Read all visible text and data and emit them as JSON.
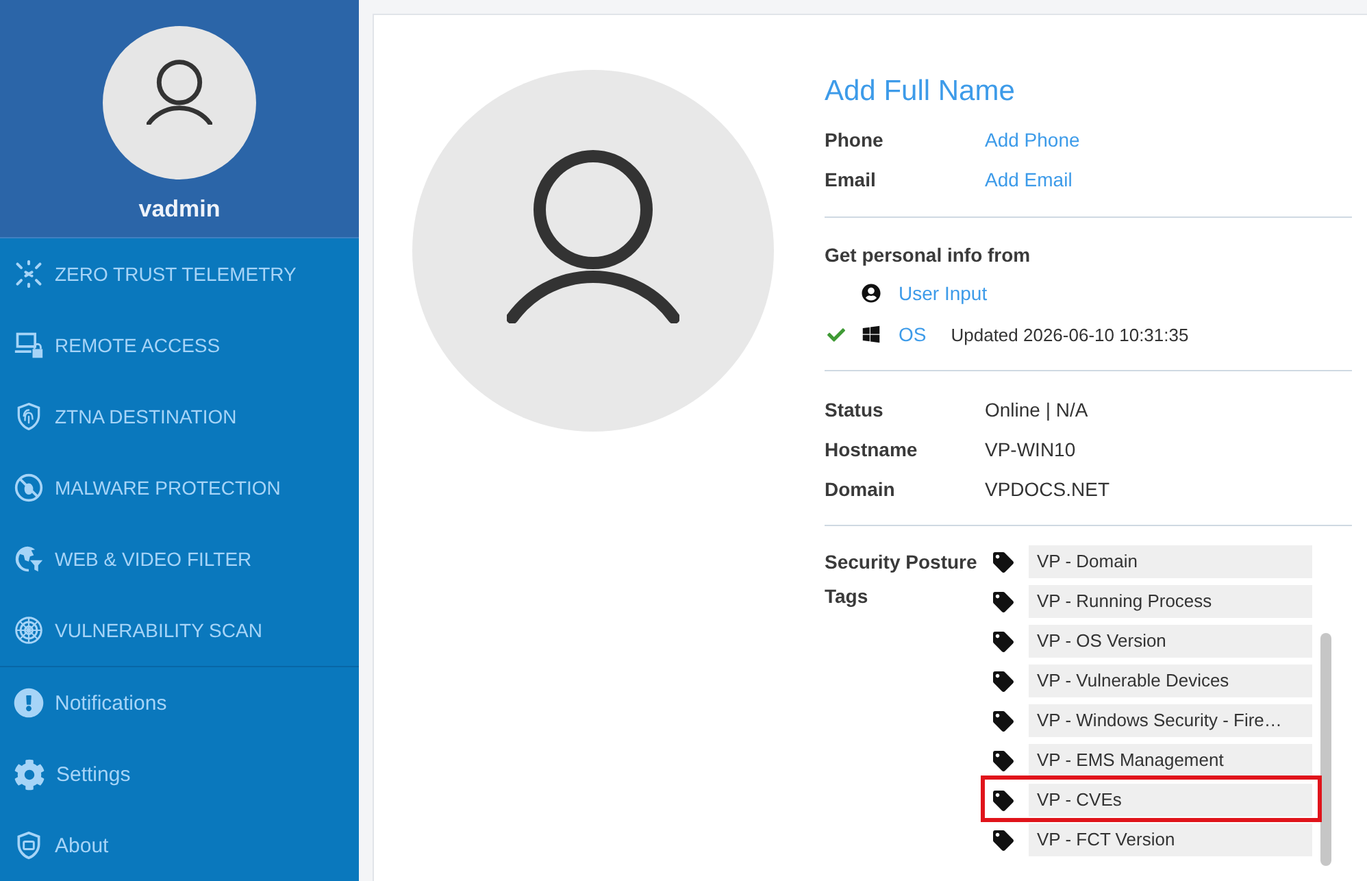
{
  "sidebar": {
    "user": {
      "name": "vadmin"
    },
    "modules": [
      {
        "label": "ZERO TRUST TELEMETRY"
      },
      {
        "label": "REMOTE ACCESS"
      },
      {
        "label": "ZTNA DESTINATION"
      },
      {
        "label": "MALWARE PROTECTION"
      },
      {
        "label": "WEB & VIDEO FILTER"
      },
      {
        "label": "VULNERABILITY SCAN"
      }
    ],
    "footer_items": [
      {
        "label": "Notifications"
      },
      {
        "label": "Settings"
      },
      {
        "label": "About"
      }
    ]
  },
  "profile": {
    "full_name": "Add Full Name",
    "contacts": [
      {
        "label": "Phone",
        "value": "Add Phone"
      },
      {
        "label": "Email",
        "value": "Add Email"
      }
    ],
    "info_source": {
      "heading": "Get personal info from",
      "sources": [
        {
          "kind": "user",
          "label": "User Input",
          "checked": false
        },
        {
          "kind": "os",
          "label": "OS",
          "checked": true,
          "updated": "Updated 2026-06-10 10:31:35"
        }
      ]
    },
    "details": [
      {
        "label": "Status",
        "value": "Online | N/A"
      },
      {
        "label": "Hostname",
        "value": "VP-WIN10"
      },
      {
        "label": "Domain",
        "value": "VPDOCS.NET"
      }
    ],
    "tags": {
      "label": "Security Posture Tags",
      "items": [
        {
          "label": "VP - Domain",
          "highlighted": false
        },
        {
          "label": "VP - Running Process",
          "highlighted": false
        },
        {
          "label": "VP - OS Version",
          "highlighted": false
        },
        {
          "label": "VP - Vulnerable Devices",
          "highlighted": false
        },
        {
          "label": "VP - Windows Security - Fire…",
          "highlighted": false
        },
        {
          "label": "VP - EMS Management",
          "highlighted": false
        },
        {
          "label": "VP - CVEs",
          "highlighted": true
        },
        {
          "label": "VP - FCT Version",
          "highlighted": false
        }
      ]
    }
  }
}
